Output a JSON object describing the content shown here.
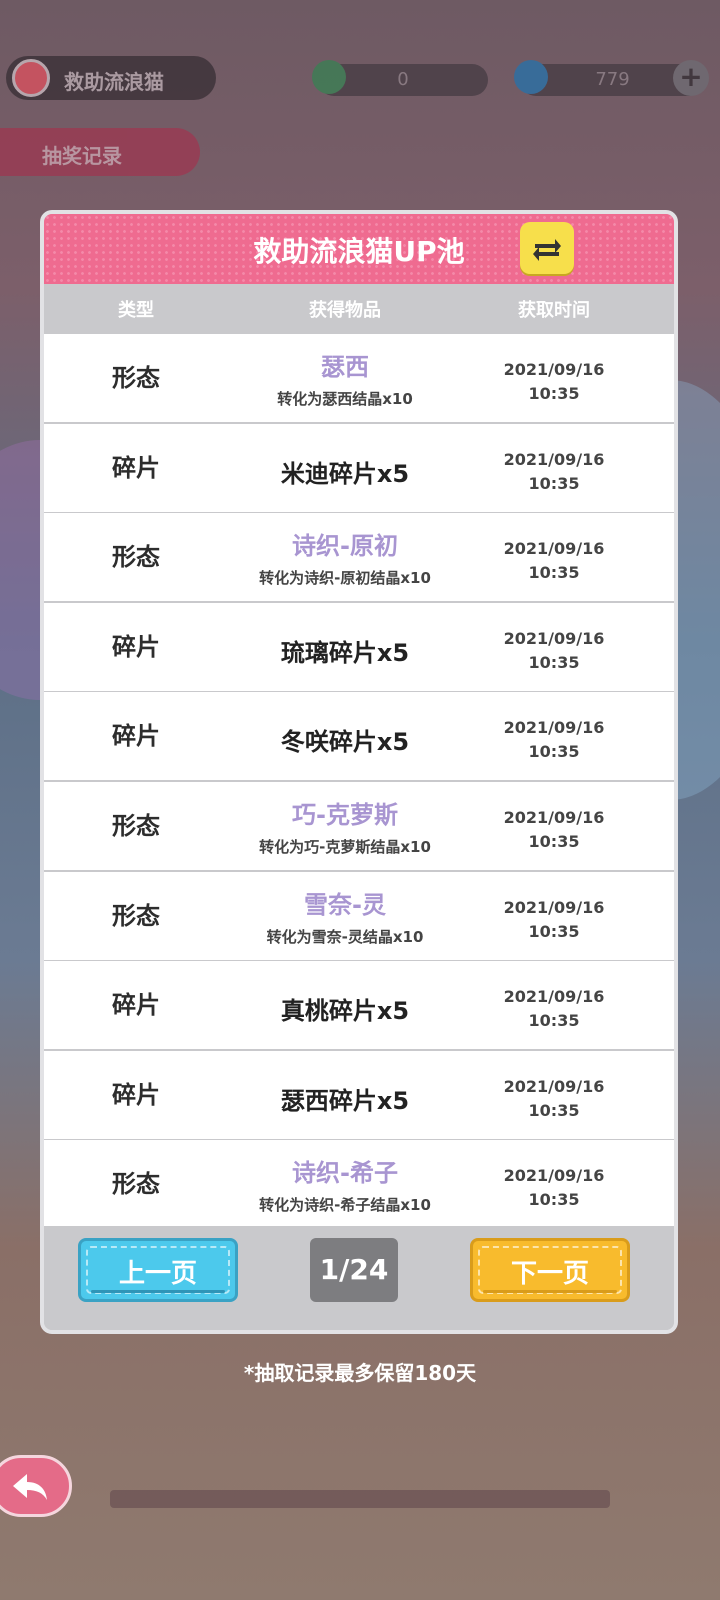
{
  "background": {
    "event_title": "救助流浪猫",
    "record_tab": "抽奖记录",
    "currency1_value": "0",
    "currency2_value": "779"
  },
  "modal": {
    "title": "救助流浪猫UP池",
    "columns": {
      "type": "类型",
      "item": "获得物品",
      "time": "获取时间"
    },
    "rows": [
      {
        "type": "形态",
        "kind": "form",
        "item": "瑟西",
        "sub": "转化为瑟西结晶x10",
        "date": "2021/09/16",
        "clock": "10:35"
      },
      {
        "type": "碎片",
        "kind": "frag",
        "item": "米迪碎片x5",
        "sub": "",
        "date": "2021/09/16",
        "clock": "10:35"
      },
      {
        "type": "形态",
        "kind": "form",
        "item": "诗织-原初",
        "sub": "转化为诗织-原初结晶x10",
        "date": "2021/09/16",
        "clock": "10:35"
      },
      {
        "type": "碎片",
        "kind": "frag",
        "item": "琉璃碎片x5",
        "sub": "",
        "date": "2021/09/16",
        "clock": "10:35"
      },
      {
        "type": "碎片",
        "kind": "frag",
        "item": "冬咲碎片x5",
        "sub": "",
        "date": "2021/09/16",
        "clock": "10:35"
      },
      {
        "type": "形态",
        "kind": "form",
        "item": "巧-克萝斯",
        "sub": "转化为巧-克萝斯结晶x10",
        "date": "2021/09/16",
        "clock": "10:35"
      },
      {
        "type": "形态",
        "kind": "form",
        "item": "雪奈-灵",
        "sub": "转化为雪奈-灵结晶x10",
        "date": "2021/09/16",
        "clock": "10:35"
      },
      {
        "type": "碎片",
        "kind": "frag",
        "item": "真桃碎片x5",
        "sub": "",
        "date": "2021/09/16",
        "clock": "10:35"
      },
      {
        "type": "碎片",
        "kind": "frag",
        "item": "瑟西碎片x5",
        "sub": "",
        "date": "2021/09/16",
        "clock": "10:35"
      },
      {
        "type": "形态",
        "kind": "form",
        "item": "诗织-希子",
        "sub": "转化为诗织-希子结晶x10",
        "date": "2021/09/16",
        "clock": "10:35"
      }
    ],
    "prev_label": "上一页",
    "next_label": "下一页",
    "page_indicator": "1/24"
  },
  "footnote": "*抽取记录最多保留180天",
  "colors": {
    "header_pink": "#ef6b90",
    "form_purple": "#a895d1",
    "prev_blue": "#4cc9ec",
    "next_yellow": "#f8bb2d"
  }
}
